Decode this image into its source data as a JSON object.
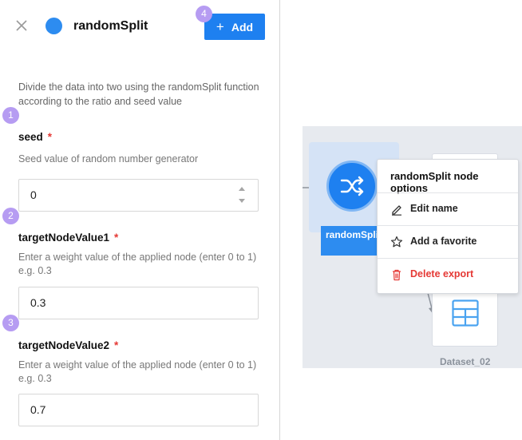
{
  "panel": {
    "title": "randomSplit",
    "add_label": "Add",
    "description": "Divide the data into two using the randomSplit function according to the ratio and seed value",
    "fields": [
      {
        "label": "seed",
        "required": "*",
        "help": "Seed value of random number generator",
        "value": "0"
      },
      {
        "label": "targetNodeValue1",
        "required": "*",
        "help": "Enter a weight value of the applied node (enter 0 to 1) e.g. 0.3",
        "value": "0.3"
      },
      {
        "label": "targetNodeValue2",
        "required": "*",
        "help": "Enter a weight value of the applied node (enter 0 to 1) e.g. 0.3",
        "value": "0.7"
      }
    ]
  },
  "badges": [
    "1",
    "2",
    "3",
    "4"
  ],
  "canvas": {
    "node_label": "randomSplit",
    "dataset_label": "Dataset_02"
  },
  "context_menu": {
    "title": "randomSplit node options",
    "items": [
      {
        "label": "Edit name",
        "icon": "pencil-icon"
      },
      {
        "label": "Add a favorite",
        "icon": "star-icon"
      },
      {
        "label": "Delete export",
        "icon": "trash-icon"
      }
    ]
  },
  "colors": {
    "accent": "#1e80f0",
    "badge": "#b69cf2",
    "required": "#e53935",
    "danger": "#e53935",
    "canvas_bg": "#e7eaef"
  }
}
